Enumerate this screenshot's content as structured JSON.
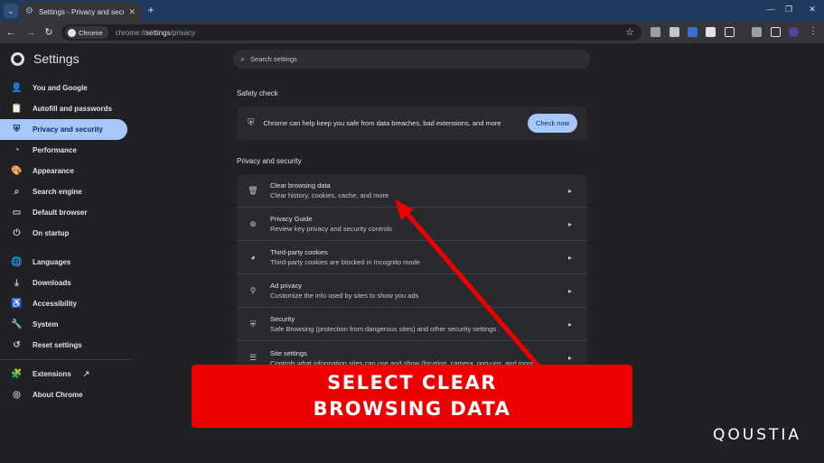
{
  "browser": {
    "tab_title": "Settings - Privacy and security",
    "tab_search_glyph": "⌄",
    "new_tab_glyph": "+",
    "close_glyph": "✕",
    "minimize_glyph": "—",
    "restore_glyph": "❐",
    "window_close_glyph": "✕",
    "back_glyph": "←",
    "forward_glyph": "→",
    "reload_glyph": "↻",
    "site_chip": "Chrome",
    "url_prefix": "chrome://",
    "url_bold": "settings",
    "url_suffix": "/privacy",
    "bookmark_glyph": "☆"
  },
  "header": {
    "title": "Settings",
    "search_placeholder": "Search settings",
    "search_glyph": "⌕"
  },
  "sidebar": {
    "items": [
      {
        "label": "You and Google",
        "icon": "person-icon",
        "glyph": "👤"
      },
      {
        "label": "Autofill and passwords",
        "icon": "clipboard-icon",
        "glyph": "📋"
      },
      {
        "label": "Privacy and security",
        "icon": "shield-icon",
        "glyph": "⛨"
      },
      {
        "label": "Performance",
        "icon": "speedometer-icon",
        "glyph": "◔"
      },
      {
        "label": "Appearance",
        "icon": "palette-icon",
        "glyph": "🎨"
      },
      {
        "label": "Search engine",
        "icon": "search-icon",
        "glyph": "⌕"
      },
      {
        "label": "Default browser",
        "icon": "browser-icon",
        "glyph": "▭"
      },
      {
        "label": "On startup",
        "icon": "power-icon",
        "glyph": "⏻"
      },
      {
        "label": "Languages",
        "icon": "globe-icon",
        "glyph": "🌐"
      },
      {
        "label": "Downloads",
        "icon": "download-icon",
        "glyph": "⤓"
      },
      {
        "label": "Accessibility",
        "icon": "accessibility-icon",
        "glyph": "♿"
      },
      {
        "label": "System",
        "icon": "wrench-icon",
        "glyph": "🔧"
      },
      {
        "label": "Reset settings",
        "icon": "history-icon",
        "glyph": "↺"
      },
      {
        "label": "Extensions",
        "icon": "puzzle-icon",
        "glyph": "🧩"
      },
      {
        "label": "About Chrome",
        "icon": "chrome-icon",
        "glyph": "◎"
      }
    ],
    "external_link_glyph": "↗"
  },
  "safety_check": {
    "heading": "Safety check",
    "text": "Chrome can help keep you safe from data breaches, bad extensions, and more",
    "button": "Check now",
    "glyph": "⛨"
  },
  "privacy": {
    "heading": "Privacy and security",
    "chevron_glyph": "▸",
    "rows": [
      {
        "title": "Clear browsing data",
        "subtitle": "Clear history, cookies, cache, and more",
        "icon": "trash-icon",
        "glyph": "🗑"
      },
      {
        "title": "Privacy Guide",
        "subtitle": "Review key privacy and security controls",
        "icon": "compass-icon",
        "glyph": "⊕"
      },
      {
        "title": "Third-party cookies",
        "subtitle": "Third-party cookies are blocked in Incognito mode",
        "icon": "cookie-icon",
        "glyph": "◕"
      },
      {
        "title": "Ad privacy",
        "subtitle": "Customize the info used by sites to show you ads",
        "icon": "ad-privacy-icon",
        "glyph": "⚲"
      },
      {
        "title": "Security",
        "subtitle": "Safe Browsing (protection from dangerous sites) and other security settings",
        "icon": "shield-icon",
        "glyph": "⛨"
      },
      {
        "title": "Site settings",
        "subtitle": "Controls what information sites can use and show (location, camera, pop-ups, and more)",
        "icon": "sliders-icon",
        "glyph": "☰"
      }
    ]
  },
  "overlay": {
    "banner_text": "SELECT CLEAR BROWSING DATA",
    "watermark": "QOUSTIA",
    "arrow_color": "#ef0000"
  }
}
